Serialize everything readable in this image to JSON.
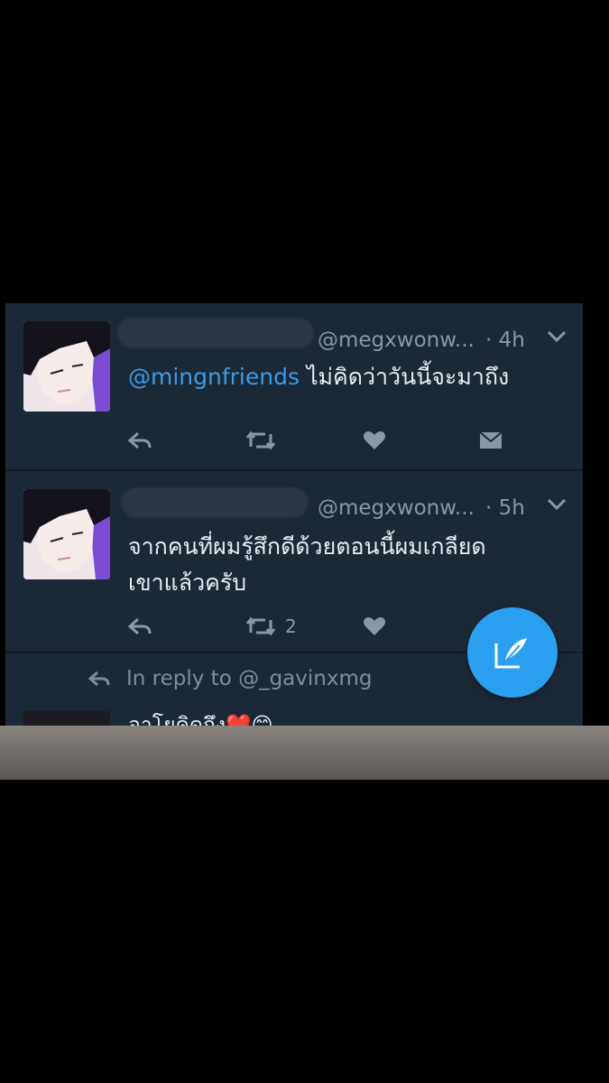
{
  "tweets": [
    {
      "handle": "@megxwonw...",
      "time": "· 4h",
      "mention": "@mingnfriends",
      "text_lines": [
        "ไม่คิดว่าวันนี้จะมาถึง"
      ],
      "retweet_count": ""
    },
    {
      "handle": "@megxwonw...",
      "time": "· 5h",
      "mention": "",
      "text_lines": [
        "จากคนที่ผมรู้สึกดีด้วยตอนนี้ผมเกลียด",
        "เขาแล้วครับ"
      ],
      "retweet_count": "2"
    }
  ],
  "reply_context": "In reply to @_gavinxmg",
  "peek_text": "อาโยคิดถึง❤️😊",
  "colors": {
    "background": "#1b2836",
    "mention": "#3a9be6",
    "fab": "#2b9ff0",
    "muted": "#8899a6"
  },
  "icons": [
    "reply-icon",
    "retweet-icon",
    "like-icon",
    "message-icon",
    "chevron-down-icon",
    "compose-icon"
  ]
}
